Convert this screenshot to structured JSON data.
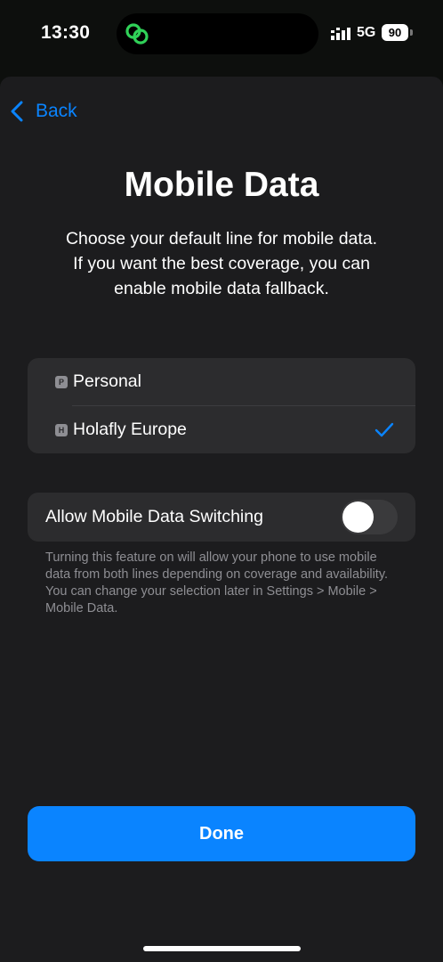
{
  "status_bar": {
    "time": "13:30",
    "network": "5G",
    "battery": "90",
    "island_icon": "linked-rings-icon",
    "island_color": "#30d158"
  },
  "nav": {
    "back_label": "Back",
    "back_icon": "chevron-left-icon"
  },
  "page": {
    "title": "Mobile Data",
    "subtitle": "Choose your default line for mobile data. If you want the best coverage, you can enable mobile data fallback."
  },
  "lines": {
    "items": [
      {
        "badge": "P",
        "label": "Personal",
        "selected": false
      },
      {
        "badge": "H",
        "label": "Holafly Europe",
        "selected": true
      }
    ]
  },
  "switching": {
    "label": "Allow Mobile Data Switching",
    "enabled": false,
    "footnote": "Turning this feature on will allow your phone to use mobile data from both lines depending on coverage and availability. You can change your selection later in Settings > Mobile > Mobile Data."
  },
  "actions": {
    "done_label": "Done"
  },
  "colors": {
    "accent": "#0a84ff",
    "background": "#1c1c1e",
    "card": "#2c2c2e"
  }
}
